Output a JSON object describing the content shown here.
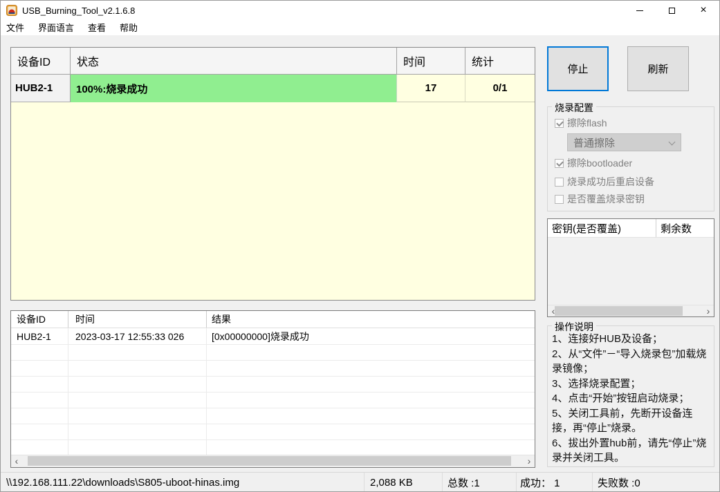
{
  "window": {
    "title": "USB_Burning_Tool_v2.1.6.8"
  },
  "menu": {
    "items": [
      "文件",
      "界面语言",
      "查看",
      "帮助"
    ]
  },
  "device_table": {
    "headers": [
      "设备ID",
      "状态",
      "时间",
      "统计"
    ],
    "rows": [
      {
        "id": "HUB2-1",
        "status": "100%:烧录成功",
        "time": "17",
        "stat": "0/1"
      }
    ]
  },
  "actions": {
    "stop": "停止",
    "refresh": "刷新"
  },
  "burn_config": {
    "title": "烧录配置",
    "erase_flash_label": "擦除flash",
    "erase_mode_value": "普通擦除",
    "erase_bootloader_label": "擦除bootloader",
    "reboot_after_label": "烧录成功后重启设备",
    "overwrite_key_label": "是否覆盖烧录密钥"
  },
  "key_table": {
    "headers": [
      "密钥(是否覆盖)",
      "剩余数"
    ]
  },
  "instructions": {
    "title": "操作说明",
    "lines": [
      "1、连接好HUB及设备；",
      "2、从“文件”－“导入烧录包”加载烧录镜像；",
      "3、选择烧录配置；",
      "4、点击“开始”按钮启动烧录；",
      "5、关闭工具前，先断开设备连接，再“停止”烧录。",
      "6、拔出外置hub前，请先“停止”烧录并关闭工具。"
    ]
  },
  "log_table": {
    "headers": [
      "设备ID",
      "时间",
      "结果"
    ],
    "rows": [
      {
        "id": "HUB2-1",
        "time": "2023-03-17 12:55:33 026",
        "result": "[0x00000000]烧录成功"
      }
    ]
  },
  "status_bar": {
    "path": "\\\\192.168.111.22\\downloads\\S805-uboot-hinas.img",
    "size": "2,088 KB",
    "total": "总数 :1",
    "success": "成功： 1",
    "failed": "失败数 :0"
  },
  "icons": {
    "scroll_left": "‹",
    "scroll_right": "›",
    "close": "×"
  },
  "colors": {
    "success_green": "#90ee90",
    "cream": "#ffffe1",
    "accent_blue": "#0078d7"
  }
}
